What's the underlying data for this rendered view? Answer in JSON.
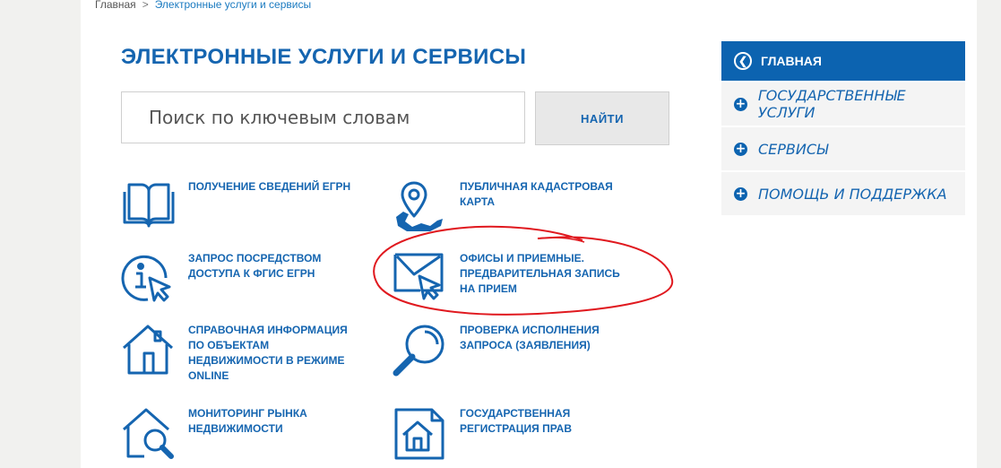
{
  "breadcrumb": {
    "home": "Главная",
    "separator": ">",
    "current": "Электронные услуги и сервисы"
  },
  "page": {
    "title": "ЭЛЕКТРОННЫЕ УСЛУГИ И СЕРВИСЫ"
  },
  "search": {
    "placeholder": "Поиск по ключевым словам",
    "button": "НАЙТИ"
  },
  "services": [
    {
      "label": "ПОЛУЧЕНИЕ СВЕДЕНИЙ ЕГРН",
      "icon": "book-icon"
    },
    {
      "label": "ПУБЛИЧНАЯ КАДАСТРОВАЯ КАРТА",
      "icon": "map-pin-icon"
    },
    {
      "label": "ЗАПРОС ПОСРЕДСТВОМ ДОСТУПА К ФГИС ЕГРН",
      "icon": "info-cursor-icon"
    },
    {
      "label": "ОФИСЫ И ПРИЕМНЫЕ. ПРЕДВАРИТЕЛЬНАЯ ЗАПИСЬ НА ПРИЕМ",
      "icon": "envelope-cursor-icon"
    },
    {
      "label": "СПРАВОЧНАЯ ИНФОРМАЦИЯ ПО ОБЪЕКТАМ НЕДВИЖИМОСТИ В РЕЖИМЕ ONLINE",
      "icon": "house-icon"
    },
    {
      "label": "ПРОВЕРКА ИСПОЛНЕНИЯ ЗАПРОСА (ЗАЯВЛЕНИЯ)",
      "icon": "magnifier-icon"
    },
    {
      "label": "МОНИТОРИНГ РЫНКА НЕДВИЖИМОСТИ",
      "icon": "house-magnifier-icon"
    },
    {
      "label": "ГОСУДАРСТВЕННАЯ РЕГИСТРАЦИЯ ПРАВ",
      "icon": "house-document-icon"
    }
  ],
  "sidebar": {
    "home": "ГЛАВНАЯ",
    "items": [
      {
        "label": "ГОСУДАРСТВЕННЫЕ УСЛУГИ"
      },
      {
        "label": "СЕРВИСЫ"
      },
      {
        "label": "ПОМОЩЬ И ПОДДЕРЖКА"
      }
    ]
  },
  "colors": {
    "accent": "#1565b0",
    "sidebar_active": "#0c63b0",
    "annotation": "#e0191f"
  }
}
